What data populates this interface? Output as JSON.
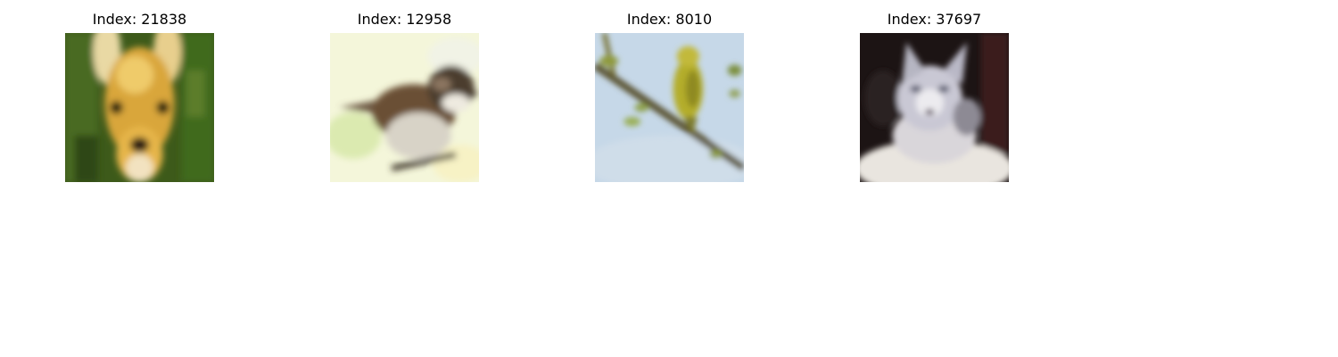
{
  "panels": [
    {
      "title": "Index: 21838",
      "subject": "deer"
    },
    {
      "title": "Index: 12958",
      "subject": "bird"
    },
    {
      "title": "Index: 8010",
      "subject": "bird"
    },
    {
      "title": "Index: 37697",
      "subject": "cat"
    }
  ]
}
